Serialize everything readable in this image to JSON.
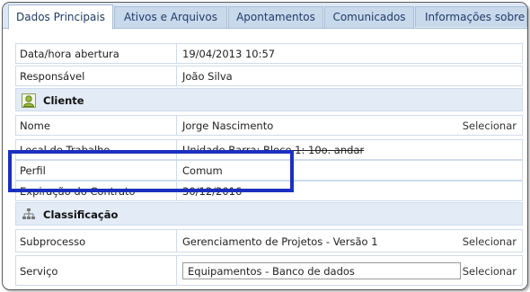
{
  "tabs": [
    "Dados Principais",
    "Ativos e Arquivos",
    "Apontamentos",
    "Comunicados",
    "Informações sobre"
  ],
  "rows": {
    "abertura": {
      "label": "Data/hora abertura",
      "value": "19/04/2013 10:57"
    },
    "responsavel": {
      "label": "Responsável",
      "value": "João Silva"
    },
    "cliente_section": "Cliente",
    "nome": {
      "label": "Nome",
      "value": "Jorge Nascimento",
      "action": "Selecionar"
    },
    "local": {
      "label": "Local de Trabalho",
      "value": "Unidade Barra: Bloco 1: 10o. andar"
    },
    "perfil": {
      "label": "Perfil",
      "value": "Comum"
    },
    "expiracao": {
      "label": "Expiração do Contrato",
      "value": "30/12/2016"
    },
    "classificacao_section": "Classificação",
    "subprocesso": {
      "label": "Subprocesso",
      "value": "Gerenciamento de Projetos - Versão 1",
      "action": "Selecionar"
    },
    "servico": {
      "label": "Serviço",
      "value": "Equipamentos - Banco de dados",
      "action": "Selecionar"
    }
  },
  "colors": {
    "tab_bg": "#c9d9ec",
    "section_bg": "#e3ebf6",
    "highlight": "#1b2fc0"
  },
  "icons": {
    "cliente": "user-icon",
    "classificacao": "hierarchy-icon"
  }
}
